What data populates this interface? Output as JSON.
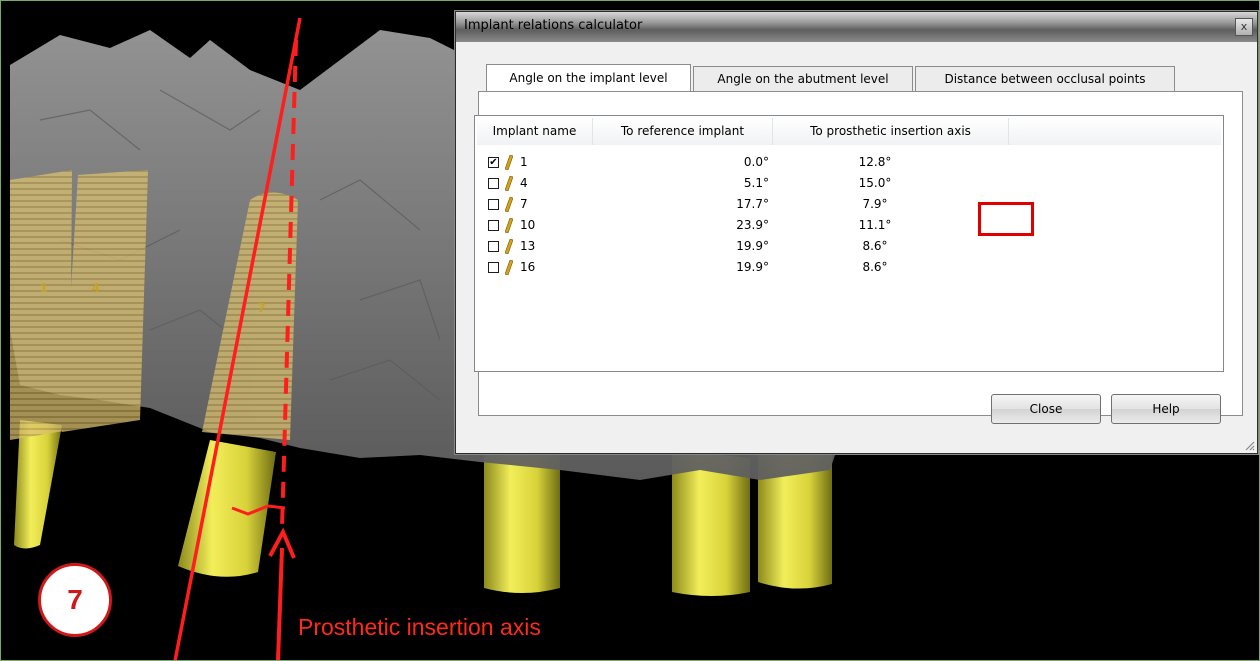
{
  "dialog": {
    "title": "Implant relations calculator",
    "close_glyph": "x",
    "tabs": [
      {
        "label": "Angle on the implant level",
        "active": true
      },
      {
        "label": "Angle on the abutment level",
        "active": false
      },
      {
        "label": "Distance between occlusal points",
        "active": false
      }
    ],
    "columns": {
      "name": "Implant name",
      "reference": "To reference implant",
      "prosthetic": "To prosthetic insertion axis"
    },
    "rows": [
      {
        "name": "1",
        "checked": true,
        "reference": "0.0°",
        "prosthetic": "12.8°"
      },
      {
        "name": "4",
        "checked": false,
        "reference": "5.1°",
        "prosthetic": "15.0°"
      },
      {
        "name": "7",
        "checked": false,
        "reference": "17.7°",
        "prosthetic": "7.9°",
        "highlighted": true
      },
      {
        "name": "10",
        "checked": false,
        "reference": "23.9°",
        "prosthetic": "11.1°"
      },
      {
        "name": "13",
        "checked": false,
        "reference": "19.9°",
        "prosthetic": "8.6°"
      },
      {
        "name": "16",
        "checked": false,
        "reference": "19.9°",
        "prosthetic": "8.6°"
      }
    ],
    "buttons": {
      "close": "Close",
      "help": "Help"
    },
    "check_glyph": "✔"
  },
  "scene": {
    "implant_labels": [
      "1",
      "4",
      "7"
    ],
    "step_number": "7",
    "axis_label": "Prosthetic insertion axis",
    "annotation_color": "#ff2a1a",
    "implant_color": "#e8e23a"
  }
}
